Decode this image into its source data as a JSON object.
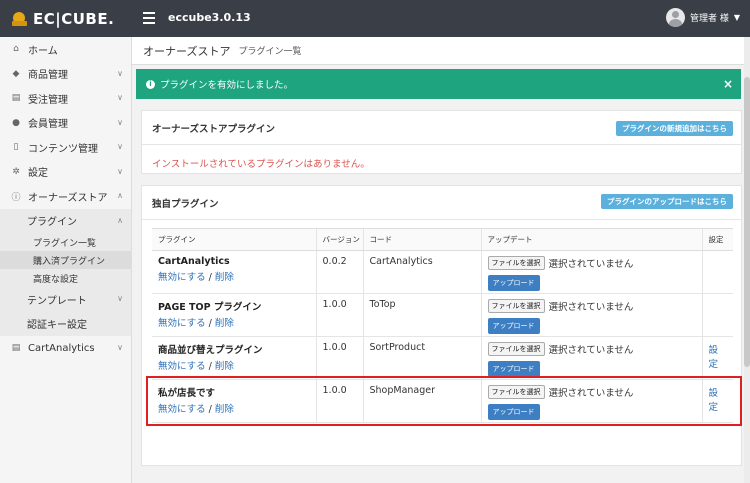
{
  "header": {
    "logo": "EC|CUBE.",
    "shop_name": "eccube3.0.13",
    "user": "管理者 様"
  },
  "sidebar": {
    "items": [
      {
        "label": "ホーム",
        "icon": "home-icon"
      },
      {
        "label": "商品管理",
        "icon": "tag-icon"
      },
      {
        "label": "受注管理",
        "icon": "cart-icon"
      },
      {
        "label": "会員管理",
        "icon": "users-icon"
      },
      {
        "label": "コンテンツ管理",
        "icon": "file-icon"
      },
      {
        "label": "設定",
        "icon": "gear-icon"
      },
      {
        "label": "オーナーズストア",
        "icon": "info-icon"
      }
    ],
    "owners_sub": {
      "plugin": "プラグイン",
      "plugin_list": "プラグイン一覧",
      "purchased": "購入済プラグイン",
      "advanced": "高度な設定",
      "template": "テンプレート",
      "auth_key": "認証キー設定"
    },
    "cart_analytics": "CartAnalytics"
  },
  "breadcrumb": {
    "main": "オーナーズストア",
    "sub": "プラグイン一覧"
  },
  "alert": {
    "message": "プラグインを有効にしました。",
    "close": "×"
  },
  "owners_box": {
    "title": "オーナーズストアプラグイン",
    "button": "プラグインの新規追加はこちら",
    "empty": "インストールされているプラグインはありません。"
  },
  "local_box": {
    "title": "独自プラグイン",
    "button": "プラグインのアップロードはこちら",
    "columns": [
      "プラグイン",
      "バージョン",
      "コード",
      "アップデート",
      "設定"
    ],
    "rows": [
      {
        "name": "CartAnalytics",
        "version": "0.0.2",
        "code": "CartAnalytics",
        "settings": ""
      },
      {
        "name": "PAGE TOP プラグイン",
        "version": "1.0.0",
        "code": "ToTop",
        "settings": ""
      },
      {
        "name": "商品並び替えプラグイン",
        "version": "1.0.0",
        "code": "SortProduct",
        "settings": "設定"
      },
      {
        "name": "私が店長です",
        "version": "1.0.0",
        "code": "ShopManager",
        "settings": "設定"
      }
    ],
    "disable": "無効にする",
    "separator": " / ",
    "delete": "削除",
    "file_button": "ファイルを選択",
    "file_status": "選択されていません",
    "upload": "アップロード"
  }
}
